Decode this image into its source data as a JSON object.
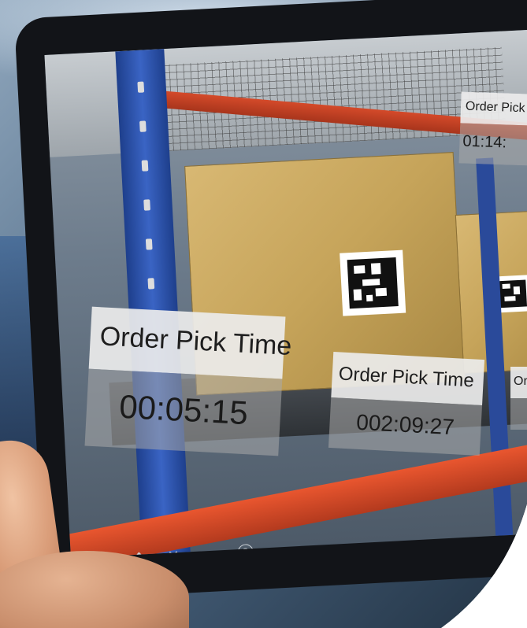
{
  "ar_labels": [
    {
      "title": "Order Pick Time",
      "value": "00:05:15"
    },
    {
      "title": "Order Pick Time",
      "value": "002:09:27"
    },
    {
      "title": "Order Pick",
      "value": "01:14:"
    },
    {
      "title": "Or",
      "value": ""
    }
  ],
  "toolbar": [
    {
      "icon": "list-icon",
      "glyph": "≡"
    },
    {
      "icon": "boxes-icon",
      "glyph": "❖"
    },
    {
      "icon": "tools-icon",
      "glyph": "✕"
    },
    {
      "icon": "trend-icon",
      "glyph": "⁓"
    },
    {
      "icon": "help-icon",
      "glyph": "?"
    }
  ],
  "colors": {
    "rack_red": "#d44a2a",
    "rack_blue": "#2a4fae",
    "box_cardboard": "#c6a45a",
    "label_header": "#ebebeb",
    "tablet_frame": "#121418"
  }
}
